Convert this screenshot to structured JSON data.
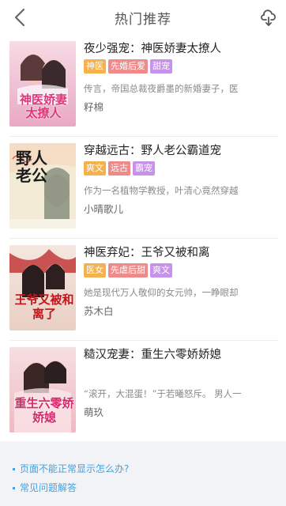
{
  "header": {
    "title": "热门推荐"
  },
  "books": [
    {
      "title": "夜少强宠：神医娇妻太撩人",
      "tags": [
        {
          "text": "神医",
          "color": "#f5b14c"
        },
        {
          "text": "先婚后爱",
          "color": "#f08a8a"
        },
        {
          "text": "甜宠",
          "color": "#c792ea"
        }
      ],
      "desc": "传言，帝国总裁夜爵墨的新婚妻子，医",
      "author": "籽棉",
      "cover_text": "神医娇妻太撩人"
    },
    {
      "title": "穿越远古：野人老公霸道宠",
      "tags": [
        {
          "text": "爽文",
          "color": "#f5b14c"
        },
        {
          "text": "远古",
          "color": "#f08a8a"
        },
        {
          "text": "霸宠",
          "color": "#c792ea"
        }
      ],
      "desc": "作为一名植物学教授，叶清心竟然穿越",
      "author": "小晴歌儿",
      "cover_text": "野人老公"
    },
    {
      "title": "神医弃妃：王爷又被和离",
      "tags": [
        {
          "text": "医女",
          "color": "#f5b14c"
        },
        {
          "text": "先虐后甜",
          "color": "#f08a8a"
        },
        {
          "text": "爽文",
          "color": "#c792ea"
        }
      ],
      "desc": "她是现代万人敬仰的女元帅，一睁眼却",
      "author": "苏木白",
      "cover_text": "王爷又被和离了"
    },
    {
      "title": "糙汉宠妻：重生六零娇娇媳",
      "tags": [],
      "desc": "“滚开，大混蛋！”于若曦怒斥。 男人一",
      "author": "萌玖",
      "cover_text": "重生六零娇娇媳"
    }
  ],
  "footer": {
    "link1": "页面不能正常显示怎么办?",
    "link2": "常见问题解答"
  }
}
